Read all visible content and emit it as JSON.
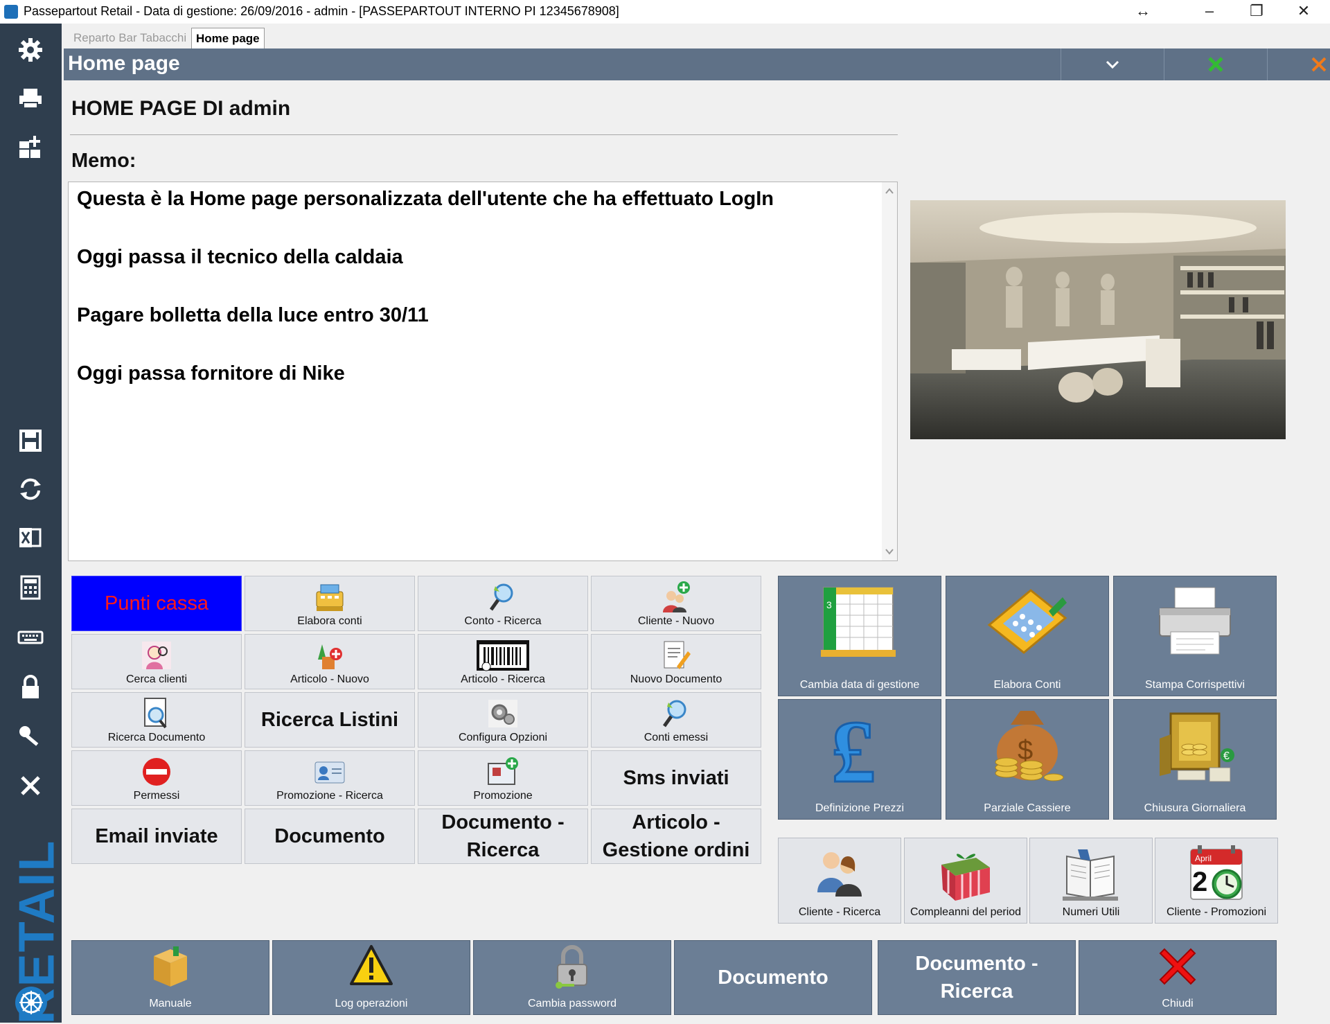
{
  "window": {
    "title": "Passepartout Retail - Data di gestione: 26/09/2016 - admin - [PASSEPARTOUT INTERNO PI 12345678908]",
    "controls": {
      "resize": "↔",
      "minimize": "–",
      "restore": "❐",
      "close": "✕"
    }
  },
  "sidebar": {
    "brand": "RETAIL",
    "icons": [
      "gear-icon",
      "printer-icon",
      "dashboard-icon",
      "save-icon",
      "refresh-icon",
      "excel-icon",
      "calculator-icon",
      "keyboard-icon",
      "lock-icon",
      "key-icon",
      "close-icon"
    ],
    "glyphs": [
      "⚙",
      "▬",
      "▦",
      "▣",
      "↻",
      "✕",
      "▦",
      "⌨",
      "🔒",
      "🔑",
      "✕"
    ]
  },
  "tabs": [
    {
      "label": "Reparto Bar Tabacchi",
      "active": false
    },
    {
      "label": "Home page",
      "active": true
    }
  ],
  "header": {
    "title": "Home page",
    "chevron": "⌄",
    "excel": "✖",
    "close": "✕"
  },
  "home": {
    "heading": "HOME PAGE DI admin",
    "memo_label": "Memo:",
    "memo_lines": [
      "Questa è la Home page personalizzata dell'utente che ha effettuato LogIn",
      "Oggi passa il tecnico della caldaia",
      "Pagare bolletta della luce entro 30/11",
      "Oggi passa fornitore di Nike"
    ]
  },
  "grid_buttons": [
    {
      "label": "Punti cassa",
      "style": "highlight",
      "icon": "none"
    },
    {
      "label": "Elabora conti",
      "style": "icon",
      "icon": "cash-register-icon"
    },
    {
      "label": "Conto - Ricerca",
      "style": "icon",
      "icon": "magnifier-icon"
    },
    {
      "label": "Cliente - Nuovo",
      "style": "icon",
      "icon": "add-customer-icon"
    },
    {
      "label": "Cerca clienti",
      "style": "icon",
      "icon": "search-customer-icon"
    },
    {
      "label": "Articolo - Nuovo",
      "style": "icon",
      "icon": "add-article-icon"
    },
    {
      "label": "Articolo - Ricerca",
      "style": "icon",
      "icon": "barcode-icon"
    },
    {
      "label": "Nuovo Documento",
      "style": "icon",
      "icon": "new-document-icon"
    },
    {
      "label": "Ricerca Documento",
      "style": "icon",
      "icon": "search-document-icon"
    },
    {
      "label": "Ricerca Listini",
      "style": "big",
      "icon": "none"
    },
    {
      "label": "Configura Opzioni",
      "style": "icon",
      "icon": "gears-icon"
    },
    {
      "label": "Conti emessi",
      "style": "icon",
      "icon": "magnifier-icon"
    },
    {
      "label": "Permessi",
      "style": "icon",
      "icon": "no-entry-icon"
    },
    {
      "label": "Promozione - Ricerca",
      "style": "icon",
      "icon": "promotion-card-icon"
    },
    {
      "label": "Promozione",
      "style": "icon",
      "icon": "promotion-add-icon"
    },
    {
      "label": "Sms inviati",
      "style": "big",
      "icon": "none"
    },
    {
      "label": "Email inviate",
      "style": "big",
      "icon": "none"
    },
    {
      "label": "Documento",
      "style": "big",
      "icon": "none"
    },
    {
      "label": "Documento - Ricerca",
      "style": "big",
      "icon": "none"
    },
    {
      "label": "Articolo - Gestione ordini",
      "style": "big",
      "icon": "none"
    }
  ],
  "big_tiles": [
    {
      "label": "Cambia data di gestione",
      "icon": "calendar-icon"
    },
    {
      "label": "Elabora Conti",
      "icon": "calculator-icon"
    },
    {
      "label": "Stampa Corrispettivi",
      "icon": "printer-icon"
    },
    {
      "label": "Definizione Prezzi",
      "icon": "pound-icon"
    },
    {
      "label": "Parziale Cassiere",
      "icon": "money-bag-icon"
    },
    {
      "label": "Chiusura Giornaliera",
      "icon": "safe-icon"
    }
  ],
  "small_tiles": [
    {
      "label": "Cliente - Ricerca",
      "icon": "people-icon"
    },
    {
      "label": "Compleanni del period",
      "icon": "gift-icon"
    },
    {
      "label": "Numeri Utili",
      "icon": "book-icon"
    },
    {
      "label": "Cliente - Promozioni",
      "icon": "april-calendar-icon",
      "cal_month": "April",
      "cal_day": "2"
    }
  ],
  "bottom_tiles": [
    {
      "label": "Manuale",
      "style": "icon",
      "icon": "box-icon"
    },
    {
      "label": "Log operazioni",
      "style": "icon",
      "icon": "warning-icon"
    },
    {
      "label": "Cambia password",
      "style": "icon",
      "icon": "padlock-icon"
    },
    {
      "label": "Documento",
      "style": "big",
      "icon": "none"
    },
    {
      "label": "Documento - Ricerca",
      "style": "big",
      "icon": "none"
    },
    {
      "label": "Chiudi",
      "style": "icon",
      "icon": "red-x-icon"
    }
  ],
  "colors": {
    "sidebar": "#2f3e4e",
    "header": "#5f7187",
    "tile": "#6b7e95",
    "highlight_bg": "#0000ff",
    "highlight_text": "#ff1a1a",
    "brand": "#1f7bc4"
  }
}
